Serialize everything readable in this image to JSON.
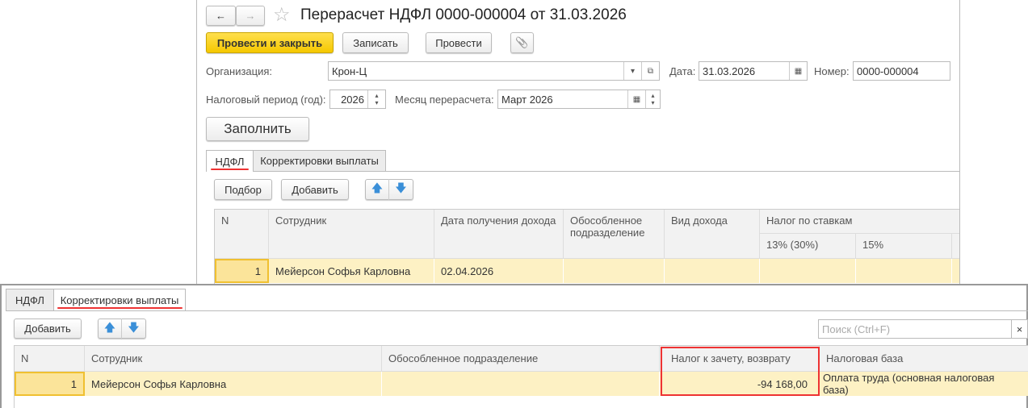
{
  "header": {
    "title": "Перерасчет НДФЛ 0000-000004 от 31.03.2026",
    "back": "←",
    "forward": "→",
    "star": "☆"
  },
  "toolbar": {
    "post_close": "Провести и закрыть",
    "save": "Записать",
    "post": "Провести",
    "attach": "📎"
  },
  "form": {
    "org_label": "Организация:",
    "org_value": "Крон-Ц",
    "date_label": "Дата:",
    "date_value": "31.03.2026",
    "number_label": "Номер:",
    "number_value": "0000-000004",
    "period_label": "Налоговый период (год):",
    "period_value": "2026",
    "month_label": "Месяц перерасчета:",
    "month_value": "Март 2026",
    "fill": "Заполнить"
  },
  "tabs": [
    "НДФЛ",
    "Корректировки выплаты"
  ],
  "ndfl": {
    "select": "Подбор",
    "add": "Добавить",
    "columns": [
      "N",
      "Сотрудник",
      "Дата получения дохода",
      "Обособленное подразделение",
      "Вид дохода",
      "Налог по ставкам",
      "13% (30%)",
      "15%"
    ],
    "row": {
      "n": "1",
      "employee": "Мейерсон Софья Карловна",
      "date": "02.04.2026"
    }
  },
  "corr": {
    "add": "Добавить",
    "search_placeholder": "Поиск (Ctrl+F)",
    "clear": "×",
    "columns": [
      "N",
      "Сотрудник",
      "Обособленное подразделение",
      "Налог к зачету, возврату",
      "Налоговая база"
    ],
    "row": {
      "n": "1",
      "employee": "Мейерсон Софья Карловна",
      "dept": "",
      "tax": "-94 168,00",
      "base": "Оплата труда (основная налоговая база)"
    }
  },
  "colors": {
    "highlight": "#e33333",
    "accent": "#f5c800"
  }
}
